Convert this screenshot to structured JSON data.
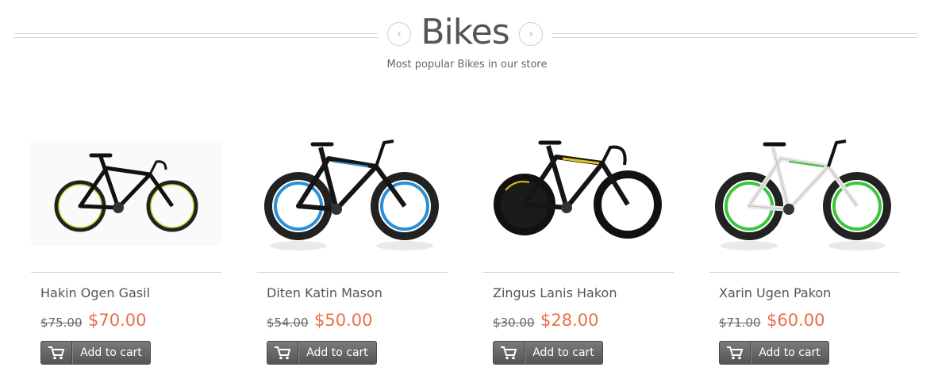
{
  "section": {
    "title": "Bikes",
    "subtitle": "Most popular Bikes in our store",
    "prev_symbol": "‹",
    "next_symbol": "›"
  },
  "products": [
    {
      "name": "Hakin Ogen Gasil",
      "old_price": "$75.00",
      "price": "$70.00",
      "cart_label": "Add to cart",
      "rim_color": "#c7d92b"
    },
    {
      "name": "Diten Katin Mason",
      "old_price": "$54.00",
      "price": "$50.00",
      "cart_label": "Add to cart",
      "rim_color": "#2a8fd6"
    },
    {
      "name": "Zingus Lanis Hakon",
      "old_price": "$30.00",
      "price": "$28.00",
      "cart_label": "Add to cart",
      "rim_color": "#111111"
    },
    {
      "name": "Xarin Ugen Pakon",
      "old_price": "$71.00",
      "price": "$60.00",
      "cart_label": "Add to cart",
      "rim_color": "#3dc43d"
    }
  ],
  "colors": {
    "accent": "#e8704b",
    "button_bg": "#5e5e5e"
  }
}
